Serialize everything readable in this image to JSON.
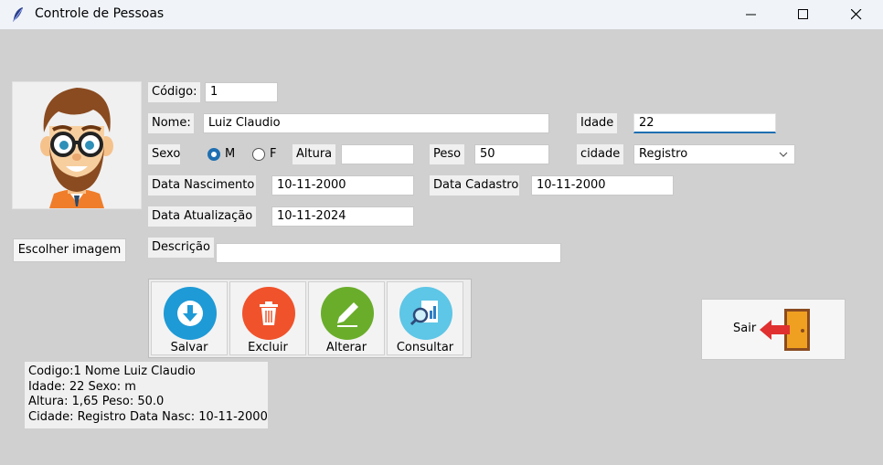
{
  "window": {
    "title": "Controle de Pessoas"
  },
  "form": {
    "codigo_label": "Código:",
    "codigo_value": "1",
    "nome_label": "Nome:",
    "nome_value": "Luiz Claudio",
    "idade_label": "Idade",
    "idade_value": "22",
    "sexo_label": "Sexo",
    "sexo_m_label": "M",
    "sexo_f_label": "F",
    "sexo_selected": "M",
    "altura_label": "Altura",
    "altura_value": "",
    "peso_label": "Peso",
    "peso_value": "50",
    "cidade_label": "cidade",
    "cidade_value": "Registro",
    "data_nascimento_label": "Data Nascimento",
    "data_nascimento_value": "10-11-2000",
    "data_cadastro_label": "Data Cadastro",
    "data_cadastro_value": "10-11-2000",
    "data_atualizacao_label": "Data Atualização",
    "data_atualizacao_value": "10-11-2024",
    "descricao_label": "Descrição",
    "descricao_value": ""
  },
  "photo": {
    "choose_label": "Escolher imagem",
    "icon": "avatar-cartoon-man"
  },
  "toolbar": {
    "buttons": [
      {
        "label": "Salvar",
        "icon": "download-icon",
        "color": "#1e9ad6"
      },
      {
        "label": "Excluir",
        "icon": "trash-icon",
        "color": "#f0522b"
      },
      {
        "label": "Alterar",
        "icon": "pencil-icon",
        "color": "#6aad2b"
      },
      {
        "label": "Consultar",
        "icon": "search-report-icon",
        "color": "#5ec6e6"
      }
    ]
  },
  "exit": {
    "label": "Sair",
    "icon": "exit-door-icon"
  },
  "summary": {
    "line1": "Codigo:1  Nome Luiz Claudio",
    "line2": " Idade: 22 Sexo: m",
    "line3": " Altura: 1,65 Peso: 50.0",
    "line4": " Cidade: Registro  Data Nasc: 10-11-2000"
  },
  "colors": {
    "background": "#d0d0d0",
    "accent": "#1f6fb2",
    "titlebar": "#f0f4f9"
  }
}
